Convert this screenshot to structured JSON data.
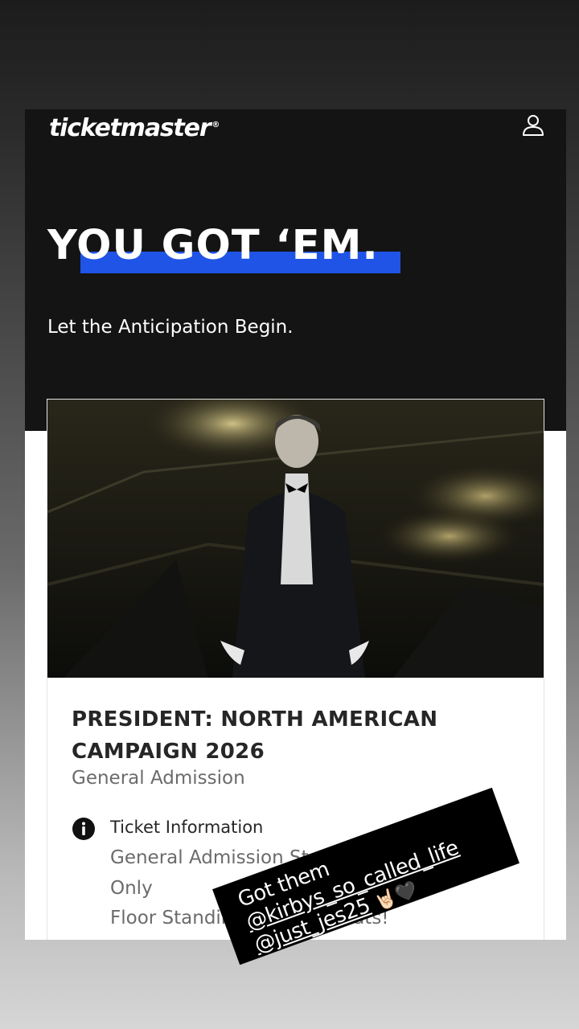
{
  "app": {
    "logo_text": "ticketmaster",
    "logo_mark": "®",
    "account_icon": "person-icon"
  },
  "hero": {
    "headline": "YOU GOT ‘EM.",
    "subline": "Let the Anticipation Begin.",
    "underline_color": "#1f54e6"
  },
  "event": {
    "title_line1": "PRESIDENT: NORTH AMERICAN",
    "title_line2": "CAMPAIGN 2026",
    "admission": "General Admission",
    "info_icon": "info-icon",
    "info_heading": "Ticket Information",
    "info_lines": [
      "General Admission Standing",
      "Only",
      "Floor Standing Only-No Seats!"
    ]
  },
  "sticker": {
    "line1": "Got them",
    "mention1": "@kirbys_so_called_life",
    "mention2": "@just_jes25",
    "emoji": "🤘🏻🖤"
  },
  "colors": {
    "header_bg": "#141414",
    "accent_blue": "#1f54e6",
    "text_dark": "#262626",
    "text_muted": "#6b6b6b"
  }
}
